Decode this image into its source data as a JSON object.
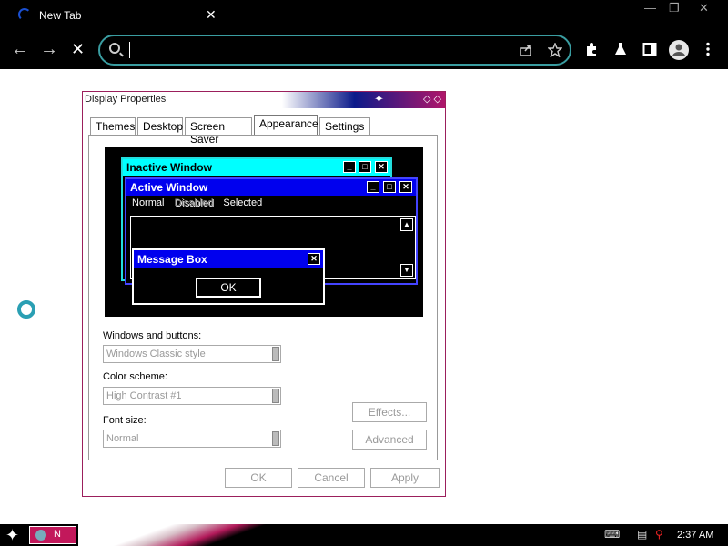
{
  "browser": {
    "tab_title": "New Tab",
    "tab_close": "✕",
    "controls": {
      "minimize": "—",
      "restore": "❐",
      "close": "✕"
    },
    "nav": {
      "back": "←",
      "forward": "→",
      "stop": "✕"
    },
    "omnibox_value": "",
    "icons": [
      "share-icon",
      "star-icon",
      "extensions-icon",
      "labs-icon",
      "sidepanel-icon",
      "profile-icon",
      "menu-icon"
    ]
  },
  "dialog": {
    "title": "Display Properties",
    "tabs": [
      "Themes",
      "Desktop",
      "Screen Saver",
      "Appearance",
      "Settings"
    ],
    "active_tab": "Appearance",
    "preview": {
      "inactive_title": "Inactive Window",
      "active_title": "Active Window",
      "menu_normal": "Normal",
      "menu_disabled": "Disabled",
      "menu_selected": "Selected",
      "msgbox_title": "Message Box",
      "ok": "OK"
    },
    "windows_buttons_label": "Windows and buttons:",
    "windows_buttons_value": "Windows Classic style",
    "color_scheme_label": "Color scheme:",
    "color_scheme_value": "High Contrast #1",
    "font_size_label": "Font size:",
    "font_size_value": "Normal",
    "effects": "Effects...",
    "advanced": "Advanced",
    "ok": "OK",
    "cancel": "Cancel",
    "apply": "Apply"
  },
  "taskbar": {
    "time": "2:37 AM",
    "task_label": "N"
  },
  "colors": {
    "accent_teal": "#3a9da1",
    "hc_active_title": "#0000ee",
    "hc_inactive_title": "#00ffff",
    "frame_magenta": "#9b1f5c"
  }
}
